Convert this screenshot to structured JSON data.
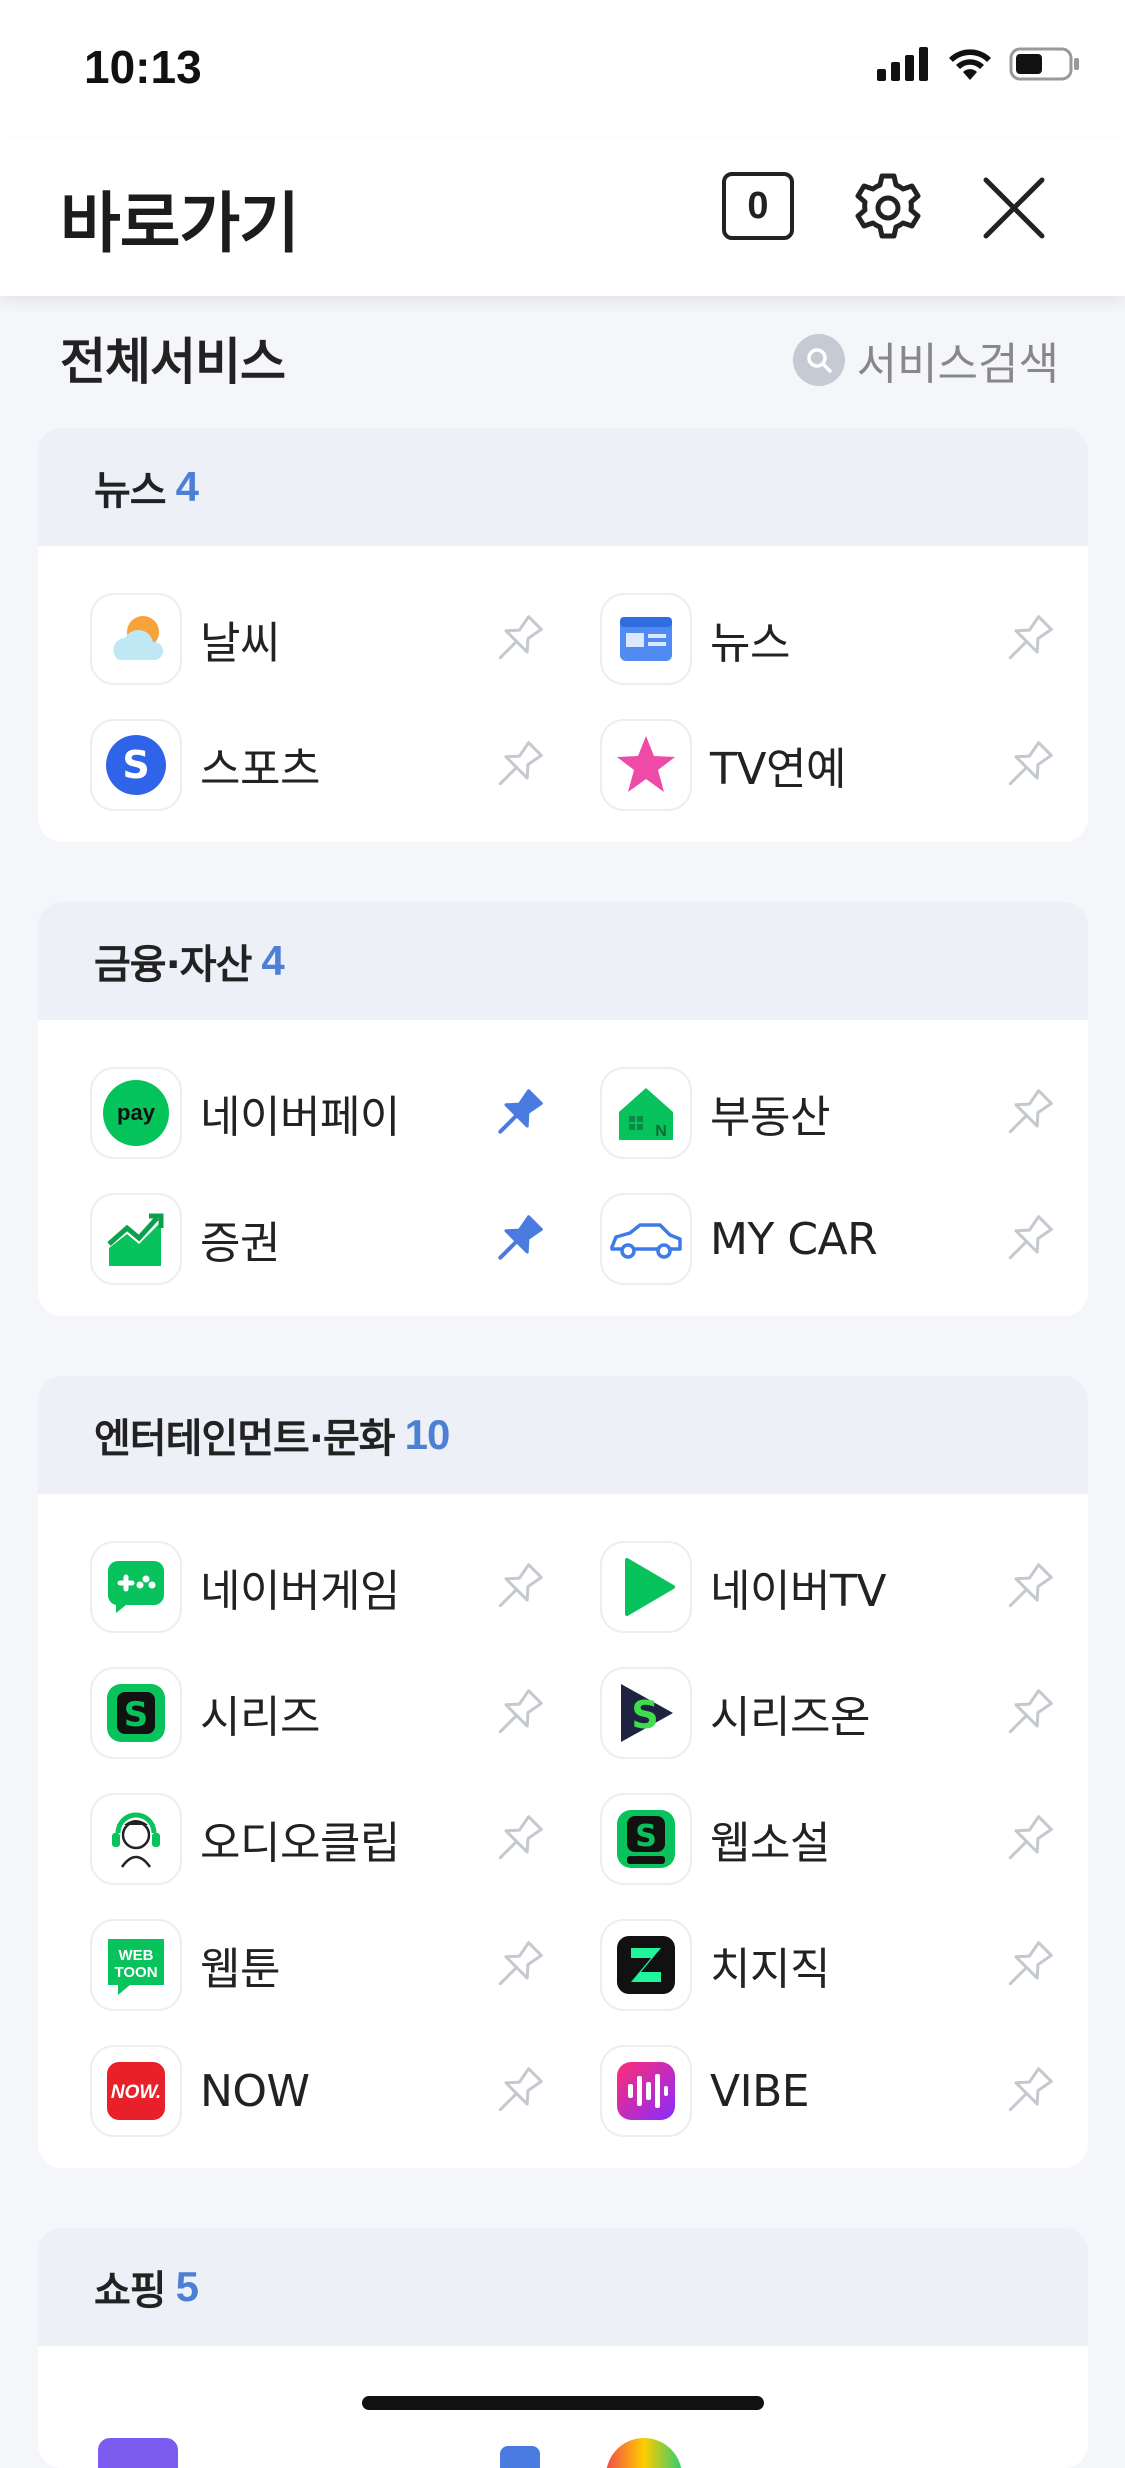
{
  "status": {
    "time": "10:13"
  },
  "header": {
    "title": "바로가기",
    "count": "0"
  },
  "section": {
    "title": "전체서비스",
    "search_label": "서비스검색"
  },
  "colors": {
    "accent": "#4d7fd4",
    "card_header": "#edf0f7",
    "pin_active": "#4a7be0"
  },
  "categories": [
    {
      "name": "뉴스",
      "count": "4",
      "items": [
        {
          "label": "날씨",
          "icon": "weather-icon",
          "pinned": false
        },
        {
          "label": "뉴스",
          "icon": "news-icon",
          "pinned": false
        },
        {
          "label": "스포츠",
          "icon": "sports-icon",
          "pinned": false
        },
        {
          "label": "TV연예",
          "icon": "star-icon",
          "pinned": false
        }
      ]
    },
    {
      "name": "금융·자산",
      "count": "4",
      "items": [
        {
          "label": "네이버페이",
          "icon": "pay-icon",
          "pinned": true
        },
        {
          "label": "부동산",
          "icon": "house-icon",
          "pinned": false
        },
        {
          "label": "증권",
          "icon": "stock-chart-icon",
          "pinned": true
        },
        {
          "label": "MY CAR",
          "icon": "car-icon",
          "pinned": false
        }
      ]
    },
    {
      "name": "엔터테인먼트·문화",
      "count": "10",
      "items": [
        {
          "label": "네이버게임",
          "icon": "gamepad-icon",
          "pinned": false
        },
        {
          "label": "네이버TV",
          "icon": "play-icon",
          "pinned": false
        },
        {
          "label": "시리즈",
          "icon": "series-icon",
          "pinned": false
        },
        {
          "label": "시리즈온",
          "icon": "series-on-icon",
          "pinned": false
        },
        {
          "label": "오디오클립",
          "icon": "audioclip-icon",
          "pinned": false
        },
        {
          "label": "웹소설",
          "icon": "webnovel-icon",
          "pinned": false
        },
        {
          "label": "웹툰",
          "icon": "webtoon-icon",
          "pinned": false
        },
        {
          "label": "치지직",
          "icon": "chzzk-icon",
          "pinned": false
        },
        {
          "label": "NOW",
          "icon": "now-icon",
          "pinned": false
        },
        {
          "label": "VIBE",
          "icon": "vibe-icon",
          "pinned": false
        }
      ]
    },
    {
      "name": "쇼핑",
      "count": "5"
    }
  ]
}
